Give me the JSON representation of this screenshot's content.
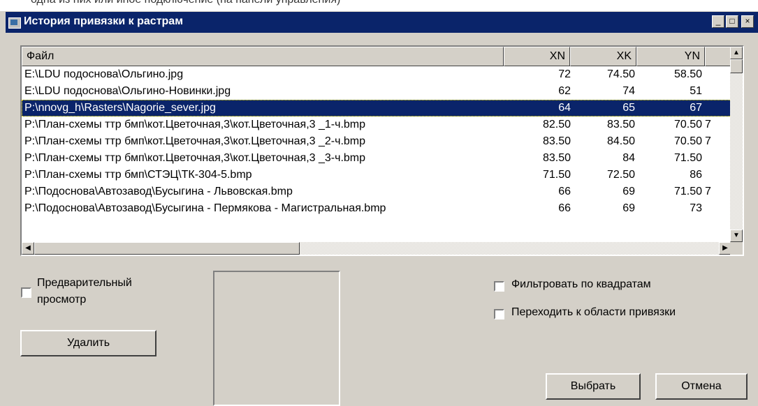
{
  "window": {
    "title": "История привязки к растрам",
    "minimize_glyph": "_",
    "maximize_glyph": "□",
    "close_glyph": "×"
  },
  "background_caption": "одна из них или иное подключение (на панели управления)",
  "table": {
    "columns": [
      "Файл",
      "XN",
      "XK",
      "YN"
    ],
    "rows": [
      {
        "file": "E:\\LDU подоснова\\Ольгино.jpg",
        "xn": "72",
        "xk": "74.50",
        "yn": "58.50",
        "yk": ""
      },
      {
        "file": "E:\\LDU подоснова\\Ольгино-Новинки.jpg",
        "xn": "62",
        "xk": "74",
        "yn": "51",
        "yk": ""
      },
      {
        "file": "P:\\nnovg_h\\Rasters\\Nagorie_sever.jpg",
        "xn": "64",
        "xk": "65",
        "yn": "67",
        "yk": ""
      },
      {
        "file": "P:\\План-схемы ттр бмп\\кот.Цветочная,3\\кот.Цветочная,3 _1-ч.bmp",
        "xn": "82.50",
        "xk": "83.50",
        "yn": "70.50",
        "yk": "7"
      },
      {
        "file": "P:\\План-схемы ттр бмп\\кот.Цветочная,3\\кот.Цветочная,3 _2-ч.bmp",
        "xn": "83.50",
        "xk": "84.50",
        "yn": "70.50",
        "yk": "7"
      },
      {
        "file": "P:\\План-схемы ттр бмп\\кот.Цветочная,3\\кот.Цветочная,3 _3-ч.bmp",
        "xn": "83.50",
        "xk": "84",
        "yn": "71.50",
        "yk": ""
      },
      {
        "file": "P:\\План-схемы ттр бмп\\СТЭЦ\\ТК-304-5.bmp",
        "xn": "71.50",
        "xk": "72.50",
        "yn": "86",
        "yk": ""
      },
      {
        "file": "P:\\Подоснова\\Автозавод\\Бусыгина - Львовская.bmp",
        "xn": "66",
        "xk": "69",
        "yn": "71.50",
        "yk": "7"
      },
      {
        "file": "P:\\Подоснова\\Автозавод\\Бусыгина - Пермякова - Магистральная.bmp",
        "xn": "66",
        "xk": "69",
        "yn": "73",
        "yk": ""
      }
    ],
    "selected_row_index": 2
  },
  "scroll_arrows": {
    "up": "▲",
    "down": "▼",
    "left": "◀",
    "right": "▶"
  },
  "options": {
    "preview_label_line1": "Предварительный",
    "preview_label_line2": "просмотр",
    "filter_label": "Фильтровать по квадратам",
    "goto_label": "Переходить к области привязки",
    "preview_checked": false,
    "filter_checked": false,
    "goto_checked": false
  },
  "buttons": {
    "delete": "Удалить",
    "select": "Выбрать",
    "cancel": "Отмена"
  },
  "colors": {
    "titlebar": "#0a246a",
    "selection": "#0a246a",
    "face": "#d4d0c8"
  }
}
